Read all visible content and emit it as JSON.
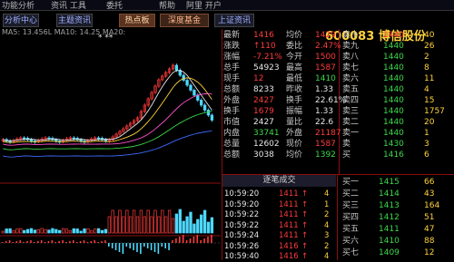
{
  "menu": [
    "功能分析",
    "资讯 工具",
    "委托",
    "帮助",
    "阿里 开户"
  ],
  "tabs": [
    {
      "label": "分析中心",
      "style": "plain"
    },
    {
      "label": "主题资讯",
      "style": "plain"
    },
    {
      "label": "热点板",
      "style": "hl"
    },
    {
      "label": "深度基金",
      "style": "hl2"
    },
    {
      "label": "上证资讯",
      "style": "plain"
    }
  ],
  "chart": {
    "ma_info": "MA5: 13.456L  MA10: 14.25  MA20:",
    "marker": "* **",
    "colors": {
      "up": "#ff3b3b",
      "down": "#4fd9ff",
      "ma5": "#e6e6e6",
      "ma10": "#ffd23c",
      "ma20": "#ff4fd0",
      "ma60": "#3cd84a",
      "ma120": "#3d6bff"
    }
  },
  "stock": {
    "code": "600083",
    "name": "博信股份",
    "price_prefix": "14"
  },
  "quote_rows": [
    {
      "l1": "最新",
      "v1": "1416",
      "l2": "均价",
      "v2": "1429",
      "c1": "red",
      "c2": "red"
    },
    {
      "l1": "涨跌",
      "v1": "↑110",
      "l2": "委比",
      "v2": "2.47%",
      "c1": "red",
      "c2": "red"
    },
    {
      "l1": "涨幅",
      "v1": "-7.21%",
      "l2": "今开",
      "v2": "1500",
      "c1": "red",
      "c2": "red"
    },
    {
      "l1": "总手",
      "v1": "54923",
      "l2": "最高",
      "v2": "1587",
      "c1": "white",
      "c2": "red"
    },
    {
      "l1": "现手",
      "v1": "12",
      "l2": "最低",
      "v2": "1410",
      "c1": "red",
      "c2": "green"
    },
    {
      "l1": "总额",
      "v1": "8233",
      "l2": "昨收",
      "v2": "1.33",
      "c1": "white",
      "c2": "white"
    },
    {
      "l1": "外盘",
      "v1": "2427",
      "l2": "换手",
      "v2": "22.61%",
      "c1": "red",
      "c2": "white"
    },
    {
      "l1": "换手",
      "v1": "1679",
      "l2": "振幅",
      "v2": "1.33",
      "c1": "red",
      "c2": "white"
    },
    {
      "l1": "市值",
      "v1": "2427",
      "l2": "量比",
      "v2": "22.6",
      "c1": "white",
      "c2": "white"
    },
    {
      "l1": "内盘",
      "v1": "33741",
      "l2": "外盘",
      "v2": "21187",
      "c1": "green",
      "c2": "red"
    },
    {
      "l1": "总量",
      "v1": "12602",
      "l2": "现价",
      "v2": "1587",
      "c1": "white",
      "c2": "red"
    },
    {
      "l1": "总额",
      "v1": "3038",
      "l2": "均价",
      "v2": "1392",
      "c1": "white",
      "c2": "green"
    }
  ],
  "order_book": [
    {
      "label": "卖十",
      "price": "1440",
      "vol": "40",
      "pc": "red"
    },
    {
      "label": "卖九",
      "price": "1440",
      "vol": "26",
      "pc": "green"
    },
    {
      "label": "卖八",
      "price": "1440",
      "vol": "2",
      "pc": "green"
    },
    {
      "label": "卖七",
      "price": "1440",
      "vol": "8",
      "pc": "green"
    },
    {
      "label": "卖六",
      "price": "1440",
      "vol": "11",
      "pc": "green"
    },
    {
      "label": "卖五",
      "price": "1440",
      "vol": "4",
      "pc": "green"
    },
    {
      "label": "卖四",
      "price": "1440",
      "vol": "15",
      "pc": "green"
    },
    {
      "label": "卖三",
      "price": "1440",
      "vol": "1757",
      "pc": "green"
    },
    {
      "label": "卖二",
      "price": "1440",
      "vol": "20",
      "pc": "green"
    },
    {
      "label": "卖一",
      "price": "1440",
      "vol": "1",
      "pc": "green"
    },
    {
      "label": "卖",
      "price": "1430",
      "vol": "3",
      "pc": "green"
    },
    {
      "label": "买",
      "price": "1416",
      "vol": "6",
      "pc": "green"
    }
  ],
  "ticks_header": "逐笔成交",
  "ticks": [
    {
      "t": "10:59:20",
      "p": "1411",
      "dir": "↑",
      "v": "4"
    },
    {
      "t": "10:59:20",
      "p": "1411",
      "dir": "↑",
      "v": "1"
    },
    {
      "t": "10:59:22",
      "p": "1411",
      "dir": "↑",
      "v": "2"
    },
    {
      "t": "10:59:22",
      "p": "1411",
      "dir": "↑",
      "v": "4"
    },
    {
      "t": "10:59:24",
      "p": "1411",
      "dir": "↑",
      "v": "3"
    },
    {
      "t": "10:59:26",
      "p": "1416",
      "dir": "↑",
      "v": "2"
    },
    {
      "t": "10:59:40",
      "p": "1416",
      "dir": "↑",
      "v": "4"
    }
  ],
  "bids": [
    {
      "label": "买一",
      "price": "1415",
      "vol": "66"
    },
    {
      "label": "买二",
      "price": "1414",
      "vol": "43"
    },
    {
      "label": "买三",
      "price": "1413",
      "vol": "164"
    },
    {
      "label": "买四",
      "price": "1412",
      "vol": "51"
    },
    {
      "label": "买五",
      "price": "1411",
      "vol": "47"
    },
    {
      "label": "买六",
      "price": "1410",
      "vol": "88"
    },
    {
      "label": "买七",
      "price": "1409",
      "vol": "12"
    }
  ]
}
